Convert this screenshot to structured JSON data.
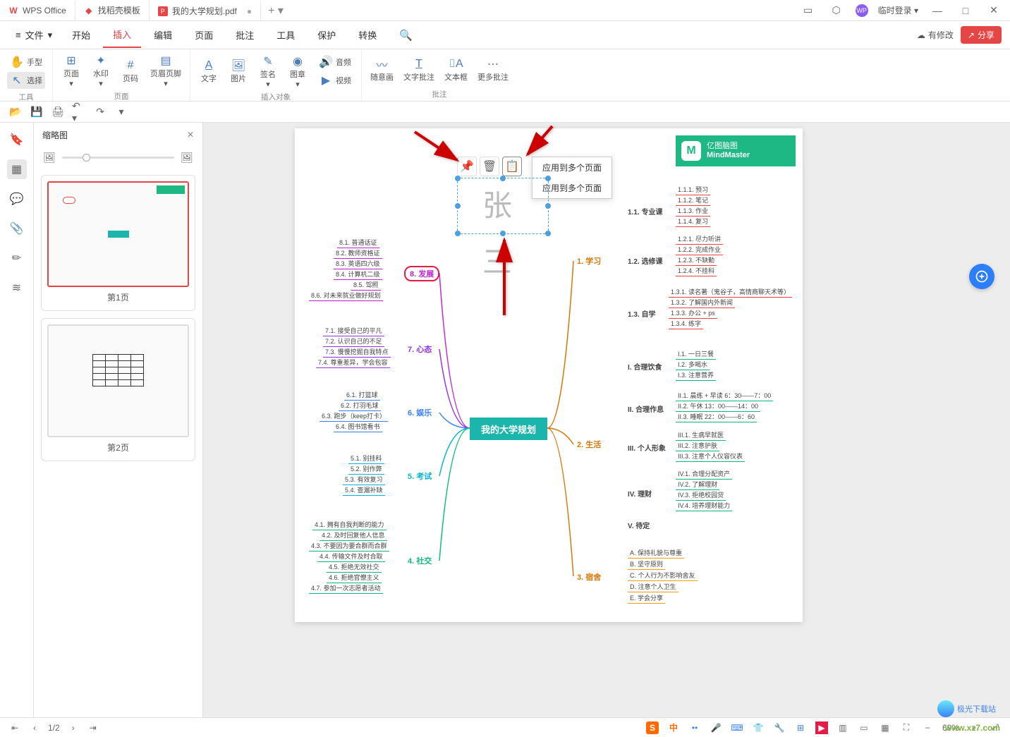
{
  "titlebar": {
    "tabs": [
      {
        "label": "WPS Office",
        "icon": "W",
        "color": "#e64545"
      },
      {
        "label": "找稻壳模板",
        "icon": "◆",
        "color": "#e64545"
      },
      {
        "label": "我的大学规划.pdf",
        "icon": "P",
        "color": "#e64545",
        "dirty": "●"
      }
    ],
    "login": "临时登录"
  },
  "menubar": {
    "file": "文件",
    "items": [
      "开始",
      "插入",
      "编辑",
      "页面",
      "批注",
      "工具",
      "保护",
      "转换"
    ],
    "active_index": 1,
    "search_icon": "search",
    "edited": "有修改",
    "share": "分享"
  },
  "ribbon": {
    "groups": [
      {
        "label": "工具",
        "stack": [
          "手型",
          "选择"
        ]
      },
      {
        "label": "页面",
        "btns": [
          "页面",
          "水印",
          "页码",
          "页眉页脚"
        ]
      },
      {
        "label": "插入对象",
        "btns": [
          "文字",
          "图片",
          "签名",
          "图章"
        ],
        "side": [
          "音频",
          "视频"
        ]
      },
      {
        "label": "批注",
        "btns": [
          "随意画",
          "文字批注",
          "文本框",
          "更多批注"
        ]
      }
    ]
  },
  "thumb": {
    "title": "缩略图",
    "pages": [
      "第1页",
      "第2页"
    ]
  },
  "signature": {
    "text": "张 三",
    "menu": [
      "应用到多个页面",
      "应用到多个页面"
    ]
  },
  "mindmaster": {
    "line1": "亿图脑图",
    "line2": "MindMaster"
  },
  "mindmap": {
    "center": "我的大学规划",
    "right": [
      {
        "title": "1. 学习",
        "sub": [
          {
            "t": "1.1. 专业课",
            "leaves": [
              "1.1.1. 预习",
              "1.1.2. 笔记",
              "1.1.3. 作业",
              "1.1.4. 复习"
            ]
          },
          {
            "t": "1.2. 选修课",
            "leaves": [
              "1.2.1. 尽力听讲",
              "1.2.2. 完成作业",
              "1.2.3. 不缺勤",
              "1.2.4. 不挂科"
            ]
          },
          {
            "t": "1.3. 自学",
            "leaves": [
              "1.3.1. 读名著（鬼谷子，高情商聊天术等）",
              "1.3.2. 了解国内外新闻",
              "1.3.3. 办公 + ps",
              "1.3.4. 练字"
            ]
          }
        ]
      },
      {
        "title": "2. 生活",
        "sub": [
          {
            "t": "I. 合理饮食",
            "leaves": [
              "I.1. 一日三餐",
              "I.2. 多喝水",
              "I.3. 注意营养"
            ]
          },
          {
            "t": "II. 合理作息",
            "leaves": [
              "II.1. 晨练 + 早读  6：30——7：00",
              "II.2. 午休  13：00——14：00",
              "II.3. 睡眠  22：00——6：60"
            ]
          },
          {
            "t": "III. 个人形象",
            "leaves": [
              "III.1. 生病早就医",
              "III.2. 注意护肤",
              "III.3. 注意个人仪容仪表"
            ]
          },
          {
            "t": "IV. 理财",
            "leaves": [
              "IV.1. 合理分配资产",
              "IV.2. 了解理财",
              "IV.3. 拒绝校园贷",
              "IV.4. 培养理财能力"
            ]
          },
          {
            "t": "V. 待定",
            "leaves": []
          }
        ]
      },
      {
        "title": "3. 宿舍",
        "sub": [
          {
            "t": "",
            "leaves": [
              "A. 保持礼貌与尊重",
              "B. 坚守原则",
              "C. 个人行为不影响舍友",
              "D. 注意个人卫生",
              "E. 学会分享"
            ]
          }
        ]
      }
    ],
    "left": [
      {
        "title": "8. 发展",
        "leaves": [
          "8.1. 普通话证",
          "8.2. 教师资格证",
          "8.3. 英语四六级",
          "8.4. 计算机二级",
          "8.5. 驾照",
          "8.6. 对未来就业做好规划"
        ]
      },
      {
        "title": "7. 心态",
        "leaves": [
          "7.1. 接受自己的平凡",
          "7.2. 认识自己的不足",
          "7.3. 慢慢挖掘自我特点",
          "7.4. 尊重差异，学会包容"
        ]
      },
      {
        "title": "6. 娱乐",
        "leaves": [
          "6.1. 打篮球",
          "6.2. 打羽毛球",
          "6.3. 跑步（keep打卡）",
          "6.4. 图书馆看书"
        ]
      },
      {
        "title": "5. 考试",
        "leaves": [
          "5.1. 别挂科",
          "5.2. 别作弊",
          "5.3. 有效复习",
          "5.4. 查漏补缺"
        ]
      },
      {
        "title": "4. 社交",
        "leaves": [
          "4.1. 拥有自我判断的能力",
          "4.2. 及时回复他人信息",
          "4.3. 不要因为要合群而合群",
          "4.4. 传输文件及时合取",
          "4.5. 拒绝无效社交",
          "4.6. 拒绝官僚主义",
          "4.7. 参加一次志愿者活动"
        ]
      }
    ]
  },
  "statusbar": {
    "page": "1/2",
    "zoom": "69%"
  },
  "watermarks": {
    "site": "www.xz7.com",
    "brand": "极光下载站"
  }
}
